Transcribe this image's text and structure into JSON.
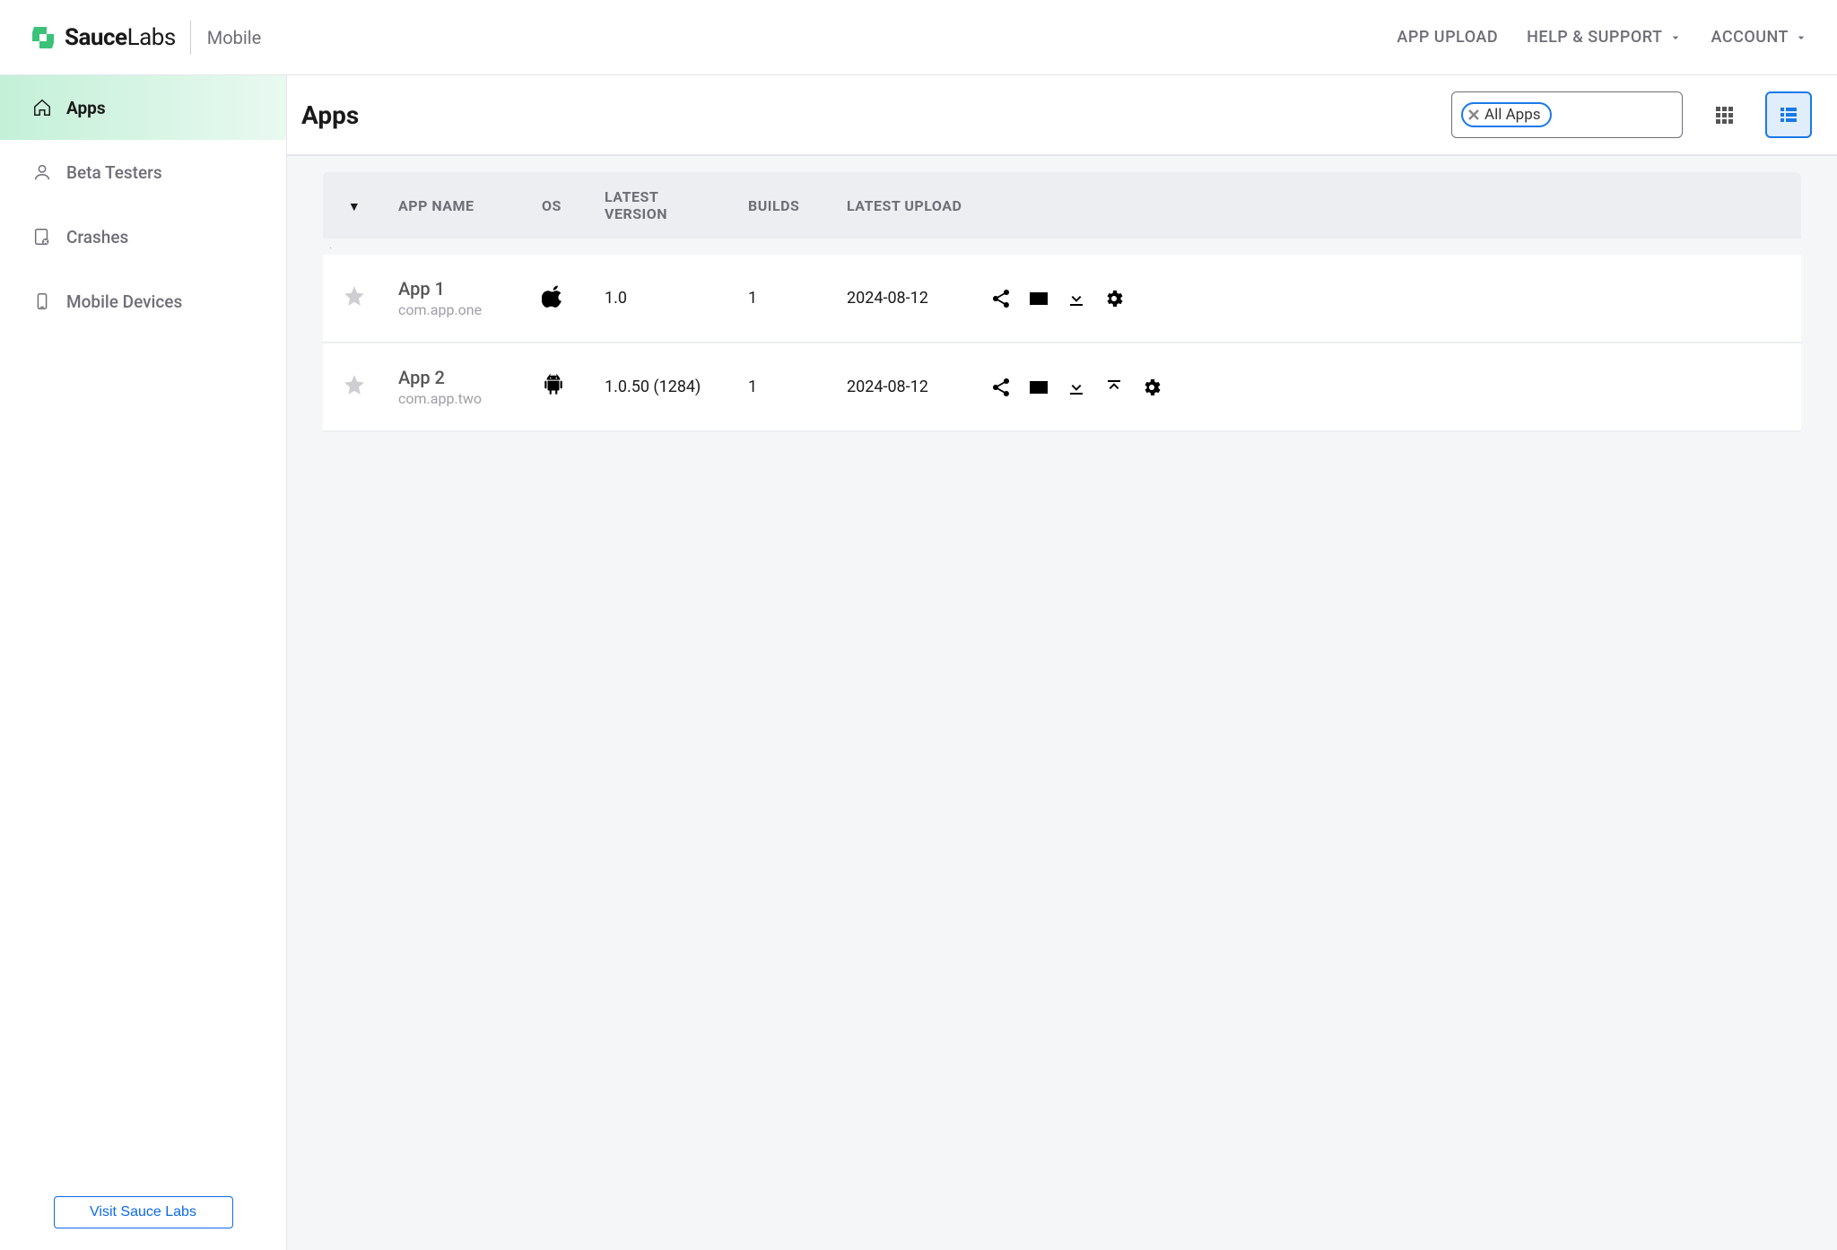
{
  "header": {
    "brand_bold": "Sauce",
    "brand_light": "Labs",
    "section": "Mobile",
    "nav": {
      "upload": "APP UPLOAD",
      "help": "HELP & SUPPORT",
      "account": "ACCOUNT"
    }
  },
  "sidebar": {
    "items": [
      {
        "label": "Apps"
      },
      {
        "label": "Beta Testers"
      },
      {
        "label": "Crashes"
      },
      {
        "label": "Mobile Devices"
      }
    ],
    "footer_button": "Visit Sauce Labs"
  },
  "page": {
    "title": "Apps",
    "filter_chip": "All Apps"
  },
  "columns": {
    "appname": "APP NAME",
    "os": "OS",
    "latest_version": "LATEST VERSION",
    "builds": "BUILDS",
    "latest_upload": "LATEST UPLOAD"
  },
  "rows": [
    {
      "name": "App 1",
      "bundle": "com.app.one",
      "os": "apple",
      "version": "1.0",
      "builds": "1",
      "upload": "2024-08-12",
      "has_upload_action": false
    },
    {
      "name": "App 2",
      "bundle": "com.app.two",
      "os": "android",
      "version": "1.0.50 (1284)",
      "builds": "1",
      "upload": "2024-08-12",
      "has_upload_action": true
    }
  ]
}
